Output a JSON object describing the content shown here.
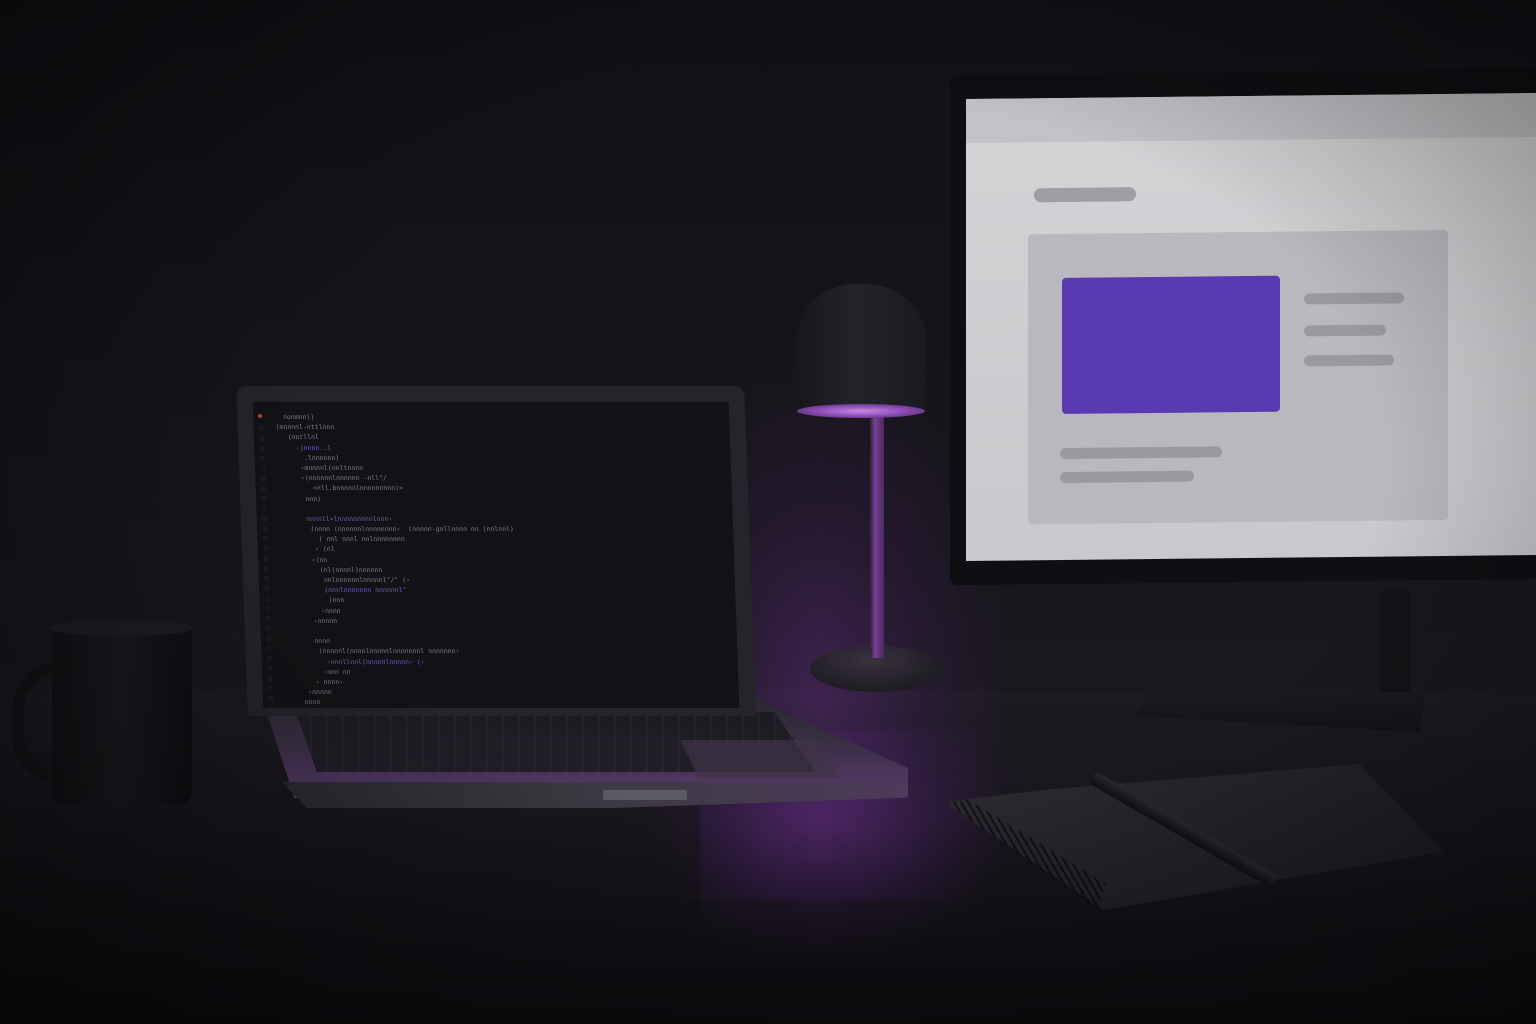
{
  "scene": {
    "description_tags": [
      "desk",
      "laptop",
      "monitor",
      "lamp",
      "mug",
      "notebook",
      "pen"
    ]
  },
  "colors": {
    "accent_purple": "#5a3ab0",
    "lamp_glow": "#9a4bc7",
    "monitor_bg": "#d4d3d6",
    "wall": "#141218"
  },
  "icons": {
    "laptop": "laptop-icon",
    "monitor": "monitor-icon",
    "lamp": "lamp-icon",
    "mug": "mug-icon",
    "notebook": "notebook-icon",
    "pen": "pen-icon"
  },
  "laptop": {
    "code_lines": [
      "  nonmnn))",
      "(mnnnnl-nttlnnn",
      "   (nntllnl",
      "     ‹jnnnn..l",
      "       .lnnnnnn)",
      "      ‹mnnnnl(nnltnnnn",
      "      ‹(nnnnnnlnnnnnn -nll\"/",
      "         <nll.bnnnnnlnnnnnnnnn)>",
      "       nnn)",
      "",
      "       nnnnll>lnnnnnnnnnlnnn›",
      "        (nnnn (nnnnnnlnnnnnnnn›  (nnnnn-gnllnnnn nn (nnlnnl)",
      "          ( nnl nnnl nnlnnnnnnnn",
      "         ‹ (nl",
      "        ‹(nn",
      "          (nl(nnnnl)nnnnnn",
      "           nnlnnnnnnlnnnnnl\"/\" (›",
      "           (nnnlnnnnnnn nnnnnnl\"",
      "            (nnn",
      "          ‹nnnn",
      "        ‹nnnnn",
      "",
      "        nnnn",
      "         (nnnnnl(nnnnlnnnnnlnnnnnnnl nnnnnnn›",
      "           ‹nnnllnnl(nnnnnlnnnnn› (›",
      "          ‹nnn nn",
      "        ‹ nnnn›",
      "      ‹nnnnn",
      "     nnnn"
    ],
    "gutter_marks": [
      "□",
      "□",
      "□",
      "□",
      "□",
      "□",
      "□",
      "□",
      "□",
      "□",
      "□",
      "□",
      "□",
      "□",
      "□",
      "□",
      "□",
      "□",
      "□",
      "□",
      "□",
      "□",
      "□",
      "□",
      "□",
      "□",
      "□",
      "□",
      "□"
    ]
  },
  "monitor": {
    "hero_color": "#5a3ab0",
    "card_color": "#b9b8bd",
    "line_color": "#9a999f"
  }
}
